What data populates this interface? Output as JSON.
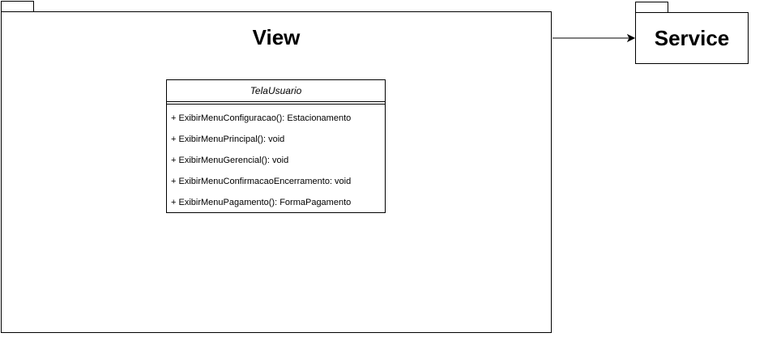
{
  "packages": {
    "view": {
      "title": "View"
    },
    "service": {
      "title": "Service"
    }
  },
  "class": {
    "name": "TelaUsuario",
    "methods": [
      "+ ExibirMenuConfiguracao(): Estacionamento",
      "+ ExibirMenuPrincipal(): void",
      "+ ExibirMenuGerencial(): void",
      "+ ExibirMenuConfirmacaoEncerramento: void",
      "+ ExibirMenuPagamento(): FormaPagamento"
    ]
  }
}
